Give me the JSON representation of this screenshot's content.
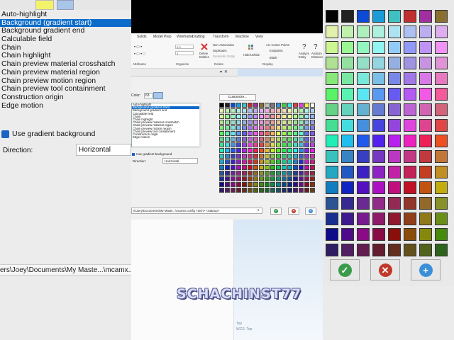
{
  "left_panel": {
    "items": [
      "Auto-highlight",
      "Background (gradient start)",
      "Background gradient end",
      "Calculable field",
      "Chain",
      "Chain highlight",
      "Chain preview material crosshatch",
      "Chain preview material region",
      "Chain preview motion region",
      "Chain preview tool containment",
      "Construction origin",
      "Edge motion"
    ],
    "selected_index": 1,
    "gradient_label": "Use gradient background",
    "direction_label": "Direction:",
    "direction_value": "Horizontal",
    "path_text": "ers\\Joey\\Documents\\My Maste...\\mcamx..."
  },
  "ribbon": {
    "tabs": [
      "Solids",
      "Model Prep",
      "Wireframe",
      "Drafting",
      "Transform",
      "Machine",
      "View"
    ],
    "groups": [
      "Attributes",
      "Organize",
      "Delete",
      "Display"
    ],
    "commands": {
      "delete_entities": "Delete Entities",
      "non_associative": "Non-Associative",
      "duplicates": "Duplicates",
      "geometric_entity": "Geometric Entity",
      "hide_unhide": "Hide/Unhide",
      "arc_center_points": "Arc Center Points",
      "endpoints": "Endpoints",
      "blank": "Blank",
      "analyze_entity": "Analyze Entity",
      "analyze_distance": "Analyze Distance"
    },
    "level_value": "2.0",
    "level_value2": "1"
  },
  "subbar": {
    "controls": "▾  ✕"
  },
  "dialog": {
    "color_label": "Color:",
    "color_number": "63",
    "customize_label": "Customize...",
    "attributes": [
      "Auto-highlight",
      "Background (gradient start)",
      "Background gradient end",
      "Calculable field",
      "Chain",
      "Chain highlight",
      "Chain preview material crosshatch",
      "Chain preview material region",
      "Chain preview motion region",
      "Chain preview tool containment",
      "Construction origin",
      "Edge motion"
    ],
    "selected_index": 1,
    "gradient_label": "Use gradient background",
    "direction_label": "Direction:",
    "direction_value": "Horizontal",
    "path_value": "rs\\Joey\\Documents\\My Maste...\\mcamx.config <Inch> <Startup>",
    "ok_icon": "check-icon",
    "cancel_icon": "x-icon",
    "help_icon": "plus-icon"
  },
  "watermark": "SCHACHINST77",
  "viewcube": {
    "top": "Top",
    "wcs": "WCS: Top"
  },
  "colors": {
    "selection": "#0b6bc9",
    "ok": "#3a9c4a",
    "cancel": "#c0392b",
    "help": "#3b8fd8",
    "accent_swatch": "#a7c6e8"
  }
}
